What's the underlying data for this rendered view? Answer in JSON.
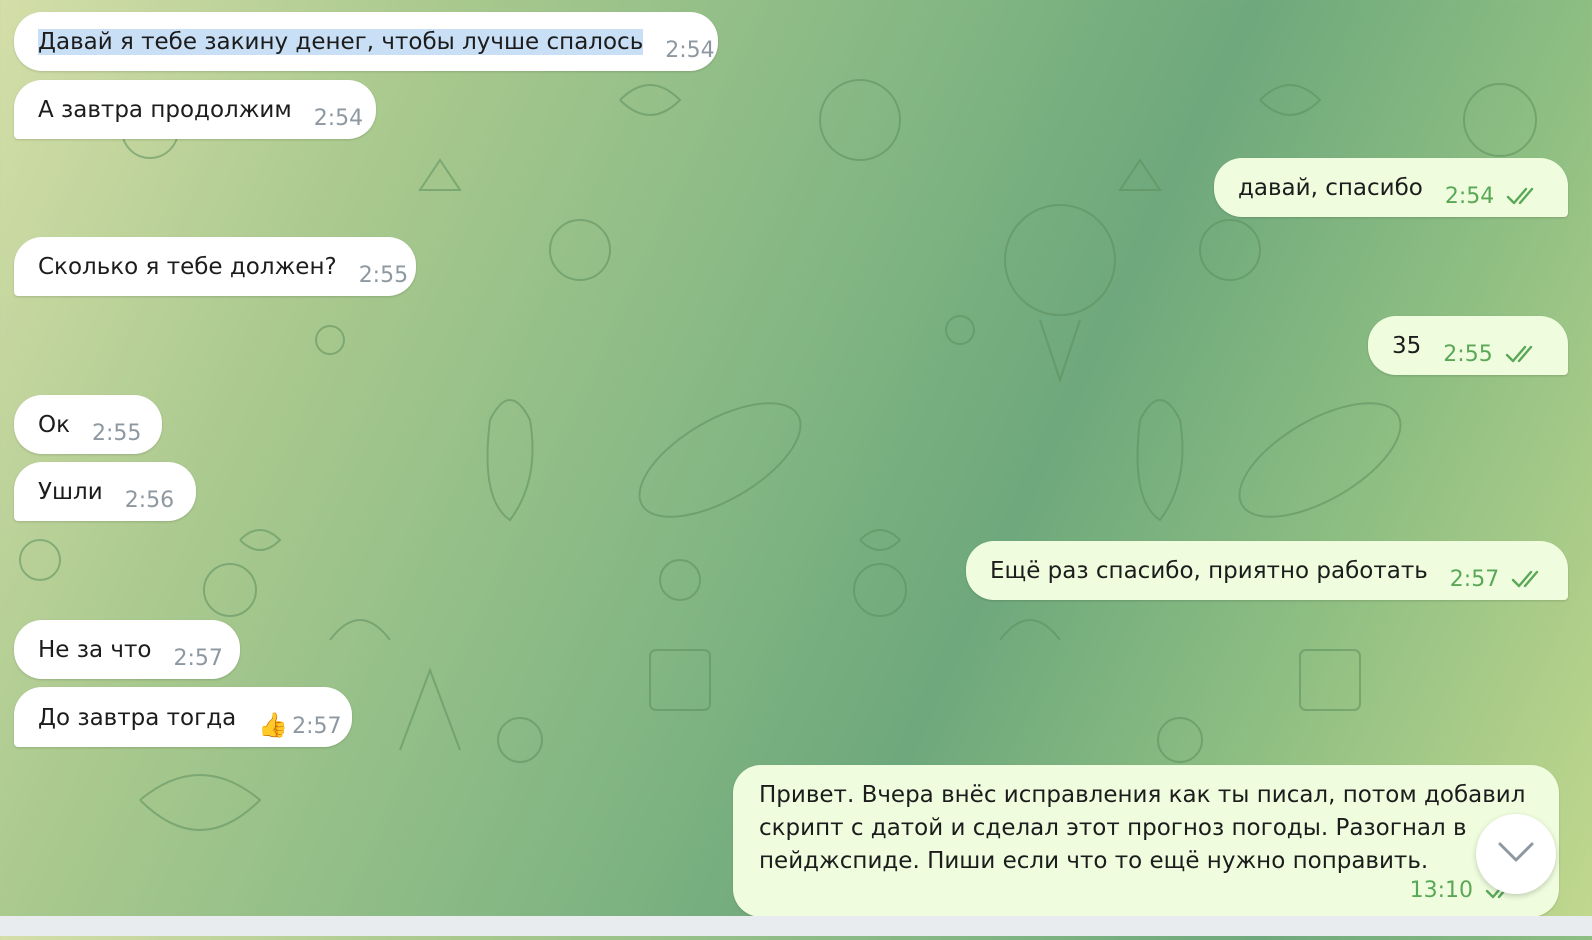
{
  "colors": {
    "incoming_bubble": "#ffffff",
    "outgoing_bubble": "#effdde",
    "outgoing_time": "#5aa857",
    "incoming_time": "#8e98a0",
    "selection": "#c9dff5"
  },
  "messages": [
    {
      "text": "Давай я тебе закину денег, чтобы лучше спалось",
      "time": "2:54"
    },
    {
      "text": "А завтра продолжим",
      "time": "2:54"
    },
    {
      "text": "давай, спасибо",
      "time": "2:54"
    },
    {
      "text": "Сколько я тебе должен?",
      "time": "2:55"
    },
    {
      "text": "35",
      "time": "2:55"
    },
    {
      "text": "Ок",
      "time": "2:55"
    },
    {
      "text": "Ушли",
      "time": "2:56"
    },
    {
      "text": "Ещё раз спасибо, приятно работать",
      "time": "2:57"
    },
    {
      "text": "Не за что",
      "time": "2:57"
    },
    {
      "text": "До завтра тогда",
      "time": "2:57",
      "reaction": "👍"
    },
    {
      "text": "Привет. Вчера внёс исправления как ты писал, потом добавил скрипт с датой и сделал этот прогноз погоды. Разогнал в пейджспиде. Пиши если что то ещё нужно поправить.",
      "time": "13:10"
    }
  ],
  "icons": {
    "read_receipt": "double-check-icon",
    "scroll_down": "chevron-down-icon",
    "reaction": "thumbs-up-icon"
  }
}
